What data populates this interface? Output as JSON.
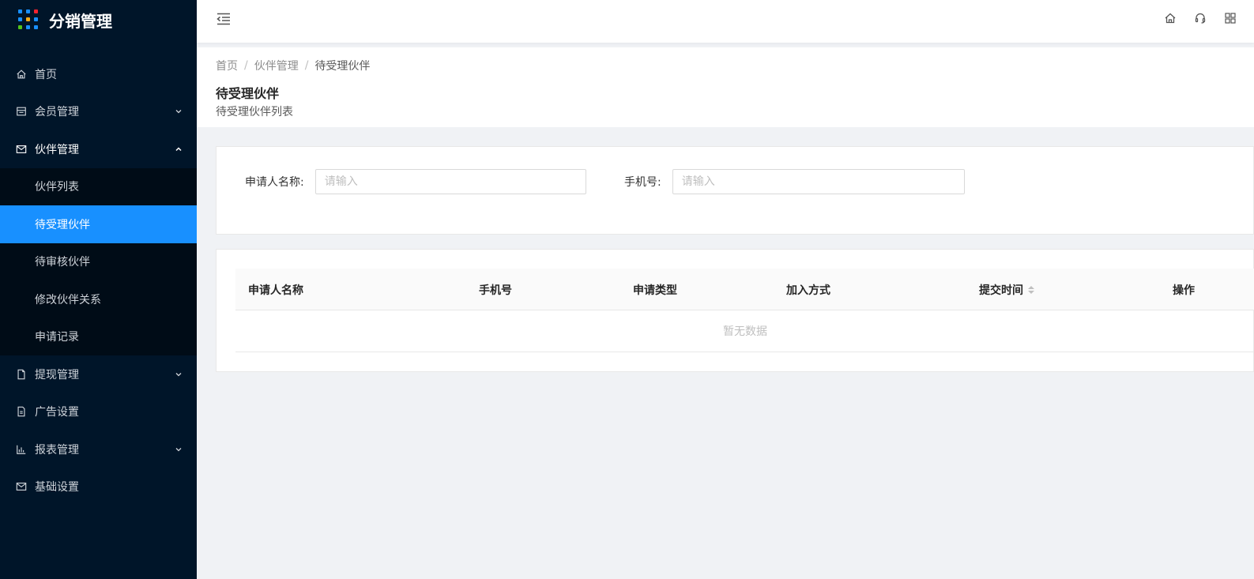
{
  "app": {
    "title": "分销管理",
    "logo_colors": [
      "#1890ff",
      "#1890ff",
      "#f5222d",
      "#1890ff",
      "#faad14",
      "#1890ff",
      "#52c41a",
      "#1890ff",
      "#1890ff"
    ]
  },
  "sidebar": {
    "items": [
      {
        "label": "首页",
        "icon": "home-icon"
      },
      {
        "label": "会员管理",
        "icon": "member-icon",
        "expandable": true
      },
      {
        "label": "伙伴管理",
        "icon": "mail-icon",
        "expandable": true,
        "open": true,
        "children": [
          {
            "label": "伙伴列表"
          },
          {
            "label": "待受理伙伴",
            "active": true
          },
          {
            "label": "待审核伙伴"
          },
          {
            "label": "修改伙伴关系"
          },
          {
            "label": "申请记录"
          }
        ]
      },
      {
        "label": "提现管理",
        "icon": "file-icon",
        "expandable": true
      },
      {
        "label": "广告设置",
        "icon": "file-text-icon"
      },
      {
        "label": "报表管理",
        "icon": "bar-chart-icon",
        "expandable": true
      },
      {
        "label": "基础设置",
        "icon": "mail-icon"
      }
    ]
  },
  "header": {
    "icons": [
      "home-icon",
      "headset-icon",
      "apps-icon"
    ]
  },
  "breadcrumb": [
    "首页",
    "伙伴管理",
    "待受理伙伴"
  ],
  "page": {
    "title": "待受理伙伴",
    "subtitle": "待受理伙伴列表"
  },
  "search": {
    "applicant_label": "申请人名称:",
    "applicant_placeholder": "请输入",
    "phone_label": "手机号:",
    "phone_placeholder": "请输入"
  },
  "table": {
    "columns": [
      "申请人名称",
      "手机号",
      "申请类型",
      "加入方式",
      "提交时间",
      "操作"
    ],
    "empty_text": "暂无数据"
  },
  "colors": {
    "sidebar_bg": "#001529",
    "submenu_bg": "#000c17",
    "accent": "#1890ff"
  }
}
